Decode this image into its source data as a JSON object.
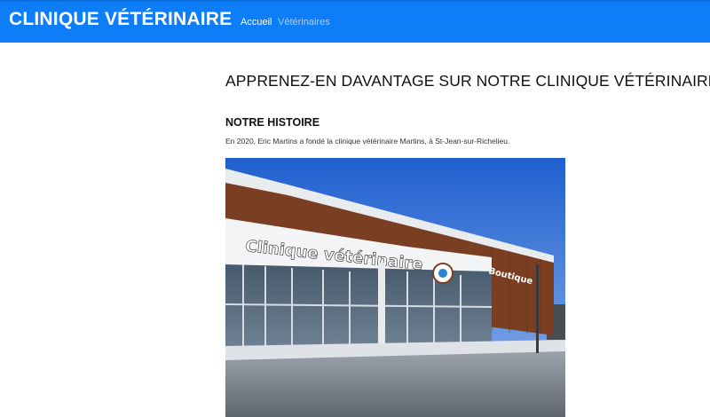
{
  "navbar": {
    "brand": "CLINIQUE VÉTÉRINAIRE",
    "links": [
      {
        "label": "Accueil",
        "active": true
      },
      {
        "label": "Vétérinaires",
        "active": false
      }
    ]
  },
  "main": {
    "title": "APPRENEZ-EN DAVANTAGE SUR NOTRE CLINIQUE VÉTÉRINAIRE",
    "history": {
      "heading": "NOTRE HISTOIRE",
      "text": "En 2020, Eric Martins a fondé la clinique vétérinaire Martins, à St-Jean-sur-Richelieu."
    },
    "photo": {
      "sign_main": "Clinique vétérinaire",
      "sign_shop": "Boutique"
    }
  },
  "colors": {
    "navbar": "#0d7ef7",
    "brand_text": "#ffffff",
    "inactive_link": "#a9cdf7",
    "facade_brown": "#7a3e22",
    "sky": "#2f6fd6"
  }
}
